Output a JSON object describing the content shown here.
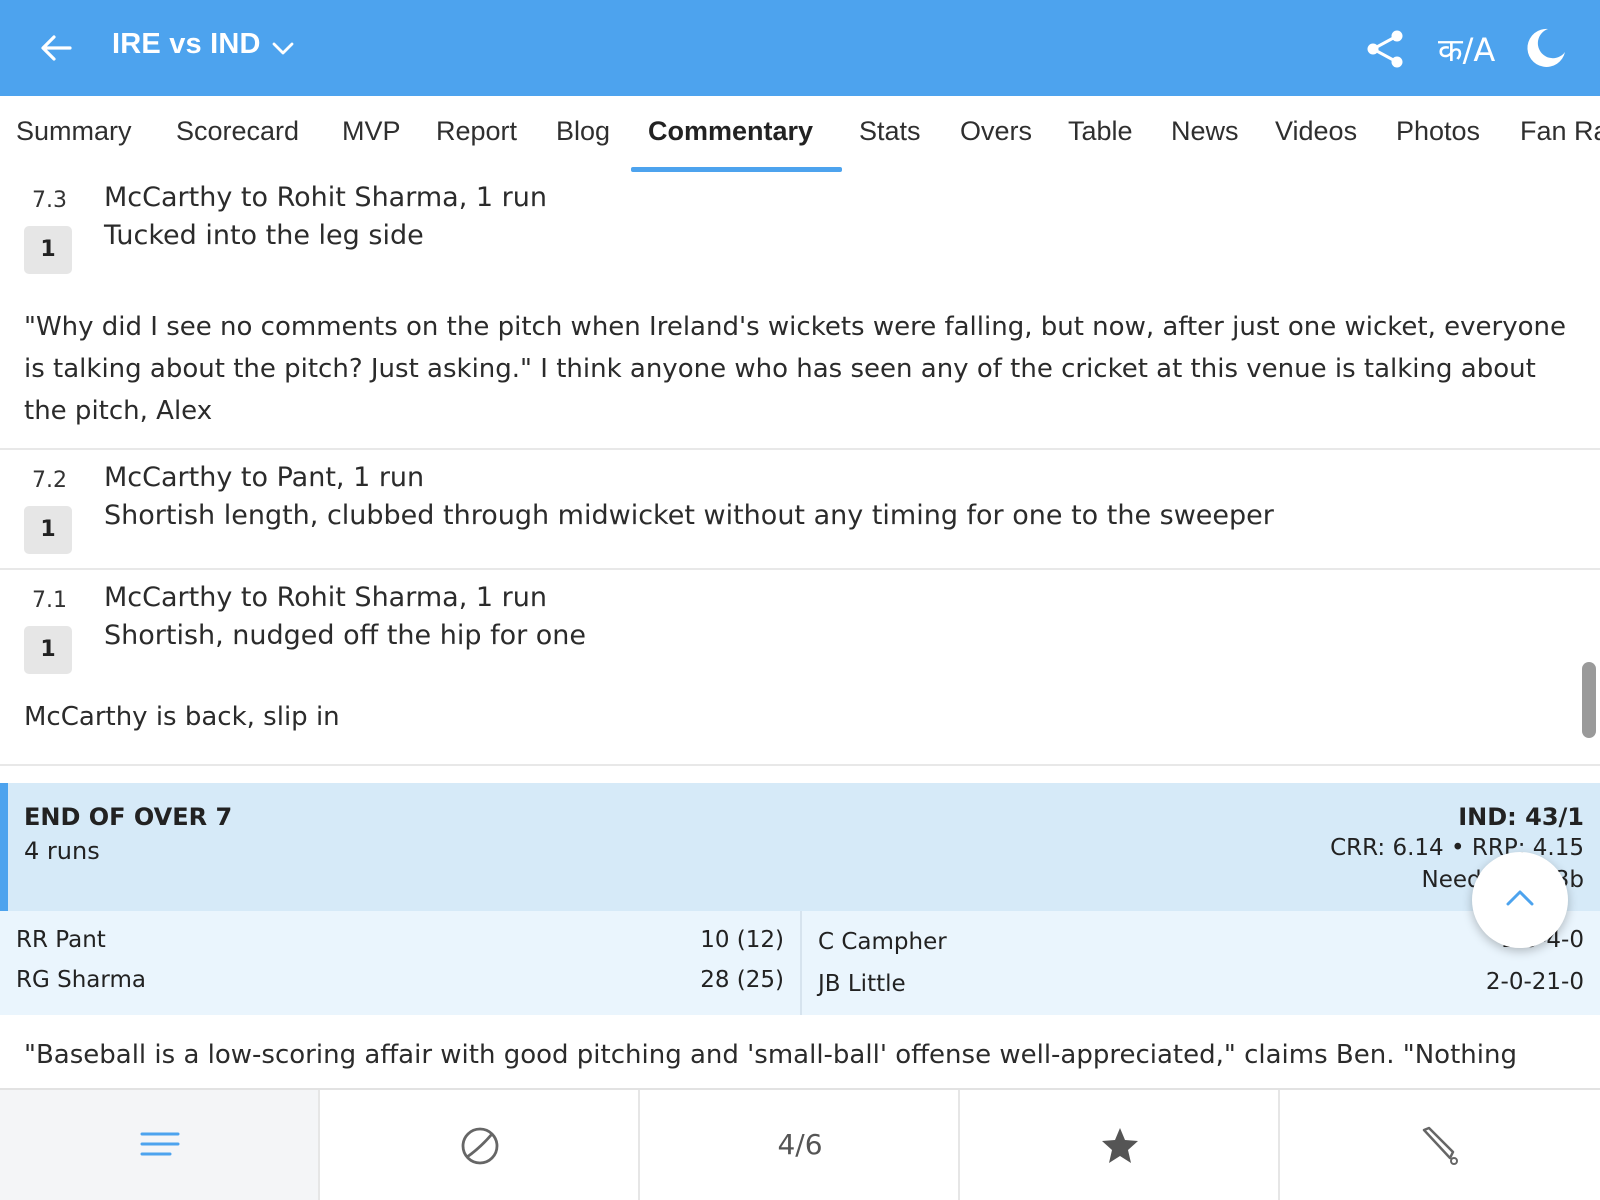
{
  "header": {
    "title": "IRE vs IND",
    "colors": {
      "bar": "#4da3ee",
      "text": "#ffffff"
    },
    "icons": [
      "back-arrow-icon",
      "chevron-down-icon",
      "share-icon",
      "language-toggle-icon",
      "dark-mode-moon-icon"
    ],
    "lang_label": "क/A"
  },
  "tabs": [
    {
      "label": "Summary"
    },
    {
      "label": "Scorecard"
    },
    {
      "label": "MVP"
    },
    {
      "label": "Report"
    },
    {
      "label": "Blog"
    },
    {
      "label": "Commentary",
      "active": true
    },
    {
      "label": "Stats"
    },
    {
      "label": "Overs"
    },
    {
      "label": "Table"
    },
    {
      "label": "News"
    },
    {
      "label": "Videos"
    },
    {
      "label": "Photos"
    },
    {
      "label": "Fan Ra"
    }
  ],
  "commentary": {
    "balls": [
      {
        "over": "7.3",
        "runs": "1",
        "headline": "McCarthy to Rohit Sharma, 1 run",
        "text": "Tucked into the leg side"
      },
      {
        "over": "7.2",
        "runs": "1",
        "headline": "McCarthy to Pant, 1 run",
        "text": "Shortish length, clubbed through midwicket without any timing for one to the sweeper"
      },
      {
        "over": "7.1",
        "runs": "1",
        "headline": "McCarthy to Rohit Sharma, 1 run",
        "text": "Shortish, nudged off the hip for one"
      }
    ],
    "notes": {
      "after_7_3": "\"Why did I see no comments on the pitch when Ireland's wickets were falling, but now, after just one wicket, everyone is talking about the pitch? Just asking.\" I think anyone who has seen any of the cricket at this venue is talking about the pitch, Alex",
      "after_7_1": "McCarthy is back, slip in",
      "trailing": "\"Baseball is a low-scoring affair with good pitching and 'small-ball' offense well-appreciated,\" claims Ben. \"Nothing"
    },
    "end_of_over": {
      "title": "END OF OVER 7",
      "runs": "4 runs",
      "score": "IND: 43/1",
      "rates": "CRR: 6.14 • RRP: 4.15",
      "need": "Need 54 ... 3b",
      "batters": [
        {
          "name": "RR Pant",
          "score": "10 (12)"
        },
        {
          "name": "RG Sharma",
          "score": "28 (25)"
        }
      ],
      "bowlers": [
        {
          "name": "C Campher",
          "figures": "1-0-4-0"
        },
        {
          "name": "JB Little",
          "figures": "2-0-21-0"
        }
      ],
      "colors": {
        "band": "#d6eaf8",
        "accent": "#4da3ee",
        "players_bg": "#eaf5fd"
      }
    }
  },
  "bottom_nav": {
    "items": [
      {
        "icon": "menu-lines-icon",
        "active": true
      },
      {
        "icon": "ball-icon"
      },
      {
        "label": "4/6"
      },
      {
        "icon": "star-icon"
      },
      {
        "icon": "cricket-bat-icon"
      }
    ],
    "accent": "#4da3ee"
  },
  "scroll_up_button": {
    "icon": "chevron-up-icon"
  }
}
